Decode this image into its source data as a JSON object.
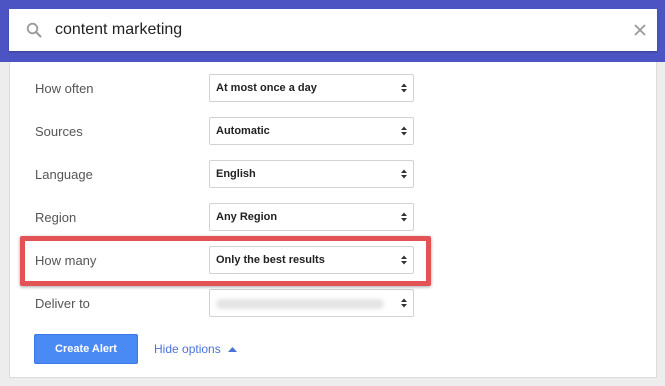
{
  "search": {
    "query": "content marketing",
    "icon": "search-icon",
    "clear_icon": "close-icon"
  },
  "options": [
    {
      "label": "How often",
      "value": "At most once a day"
    },
    {
      "label": "Sources",
      "value": "Automatic"
    },
    {
      "label": "Language",
      "value": "English"
    },
    {
      "label": "Region",
      "value": "Any Region"
    },
    {
      "label": "How many",
      "value": "Only the best results"
    },
    {
      "label": "Deliver to",
      "value": ""
    }
  ],
  "actions": {
    "create_label": "Create Alert",
    "hide_label": "Hide options"
  },
  "colors": {
    "topbar": "#4b54c2",
    "highlight": "#e35254",
    "primary_button": "#4a8af4",
    "link": "#4a73d8"
  }
}
